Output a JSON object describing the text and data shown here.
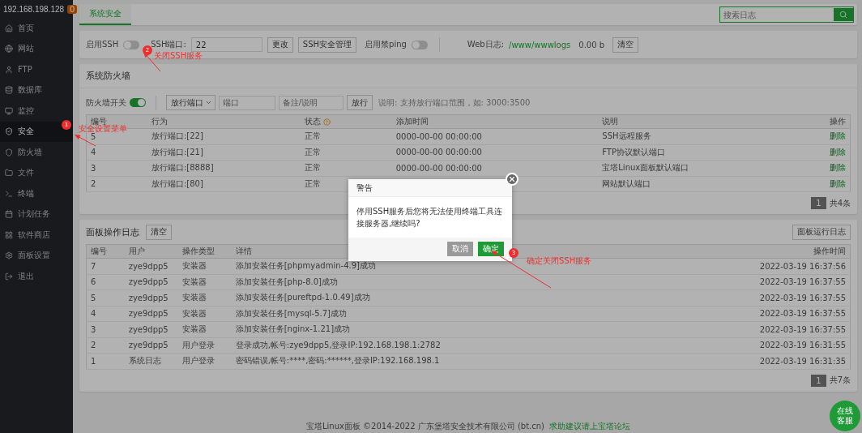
{
  "sidebar": {
    "host": "192.168.198.128",
    "badge": "0",
    "items": [
      {
        "label": "首页",
        "selected": false
      },
      {
        "label": "网站",
        "selected": false
      },
      {
        "label": "FTP",
        "selected": false
      },
      {
        "label": "数据库",
        "selected": false
      },
      {
        "label": "监控",
        "selected": false
      },
      {
        "label": "安全",
        "selected": true
      },
      {
        "label": "防火墙",
        "selected": false
      },
      {
        "label": "文件",
        "selected": false
      },
      {
        "label": "终端",
        "selected": false
      },
      {
        "label": "计划任务",
        "selected": false
      },
      {
        "label": "软件商店",
        "selected": false
      },
      {
        "label": "面板设置",
        "selected": false
      },
      {
        "label": "退出",
        "selected": false
      }
    ]
  },
  "tabs": [
    {
      "label": "系统安全",
      "selected": true
    }
  ],
  "search": {
    "placeholder": "搜索日志"
  },
  "ssh_bar": {
    "ssh_label": "启用SSH",
    "ssh_on": false,
    "port_label": "SSH端口:",
    "port_value": "22",
    "change_button": "更改",
    "manage_button": "SSH安全管理",
    "ping_label": "启用禁ping",
    "ping_on": false,
    "web_log_label": "Web日志:",
    "web_log_path": "/www/wwwlogs",
    "web_log_size": "0.00 b",
    "clear_button": "清空"
  },
  "firewall": {
    "title": "系统防火墙",
    "switch_label": "防火墙开关",
    "on": true,
    "type_select": "放行端口",
    "port_placeholder": "端口",
    "note_placeholder": "备注/说明",
    "allow_button": "放行",
    "hint": "说明: 支持放行端口范围，如: 3000:3500",
    "columns": [
      "编号",
      "行为",
      "状态",
      "添加时间",
      "说明",
      "操作"
    ],
    "rows": [
      [
        "5",
        "放行端口:[22]",
        "正常",
        "0000-00-00 00:00:00",
        "SSH远程服务",
        "删除"
      ],
      [
        "4",
        "放行端口:[21]",
        "正常",
        "0000-00-00 00:00:00",
        "FTP协议默认端口",
        "删除"
      ],
      [
        "3",
        "放行端口:[8888]",
        "正常",
        "0000-00-00 00:00:00",
        "宝塔Linux面板默认端口",
        "删除"
      ],
      [
        "2",
        "放行端口:[80]",
        "正常",
        "",
        "网站默认端口",
        "删除"
      ]
    ],
    "page": "1",
    "total": "共4条"
  },
  "log": {
    "title": "面板操作日志",
    "clear_button": "清空",
    "run_log_button": "面板运行日志",
    "columns": [
      "编号",
      "用户",
      "操作类型",
      "详情",
      "操作时间"
    ],
    "rows": [
      [
        "7",
        "zye9dpp5",
        "安装器",
        "添加安装任务[phpmyadmin-4.9]成功",
        "2022-03-19 16:37:56"
      ],
      [
        "6",
        "zye9dpp5",
        "安装器",
        "添加安装任务[php-8.0]成功",
        "2022-03-19 16:37:55"
      ],
      [
        "5",
        "zye9dpp5",
        "安装器",
        "添加安装任务[pureftpd-1.0.49]成功",
        "2022-03-19 16:37:55"
      ],
      [
        "4",
        "zye9dpp5",
        "安装器",
        "添加安装任务[mysql-5.7]成功",
        "2022-03-19 16:37:55"
      ],
      [
        "3",
        "zye9dpp5",
        "安装器",
        "添加安装任务[nginx-1.21]成功",
        "2022-03-19 16:37:55"
      ],
      [
        "2",
        "zye9dpp5",
        "用户登录",
        "登录成功,帐号:zye9dpp5,登录IP:192.168.198.1:2782",
        "2022-03-19 16:31:55"
      ],
      [
        "1",
        "系统日志",
        "用户登录",
        "密码错误,帐号:****,密码:******,登录IP:192.168.198.1",
        "2022-03-19 16:31:35"
      ]
    ],
    "page": "1",
    "total": "共7条"
  },
  "footer": {
    "text": "宝塔Linux面板 ©2014-2022 广东堡塔安全技术有限公司 (bt.cn)",
    "link": "求助建议请上宝塔论坛"
  },
  "dialog": {
    "title": "警告",
    "message": "停用SSH服务后您将无法使用终端工具连接服务器,继续吗?",
    "cancel": "取消",
    "confirm": "确定"
  },
  "annotations": [
    {
      "number": "1",
      "text": "安全设置菜单"
    },
    {
      "number": "2",
      "text": "关闭SSH服务"
    },
    {
      "number": "3",
      "text": "确定关闭SSH服务"
    }
  ],
  "chat_button": "在线客服"
}
